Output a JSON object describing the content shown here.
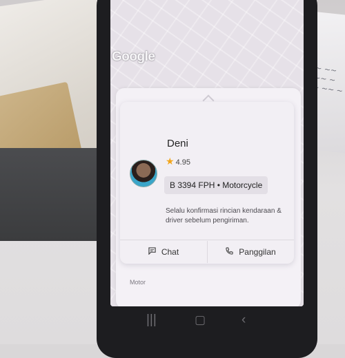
{
  "map": {
    "logo": "Google"
  },
  "driver": {
    "name": "Deni",
    "rating": "4.95",
    "vehicle": "B 3394 FPH • Motorcycle",
    "note": "Selalu konfirmasi rincian kendaraan & driver sebelum pengiriman."
  },
  "actions": {
    "chat_label": "Chat",
    "call_label": "Panggilan"
  },
  "service": {
    "label": "Motor"
  },
  "icons": {
    "star": "star-icon",
    "chat": "chat-icon",
    "phone": "phone-icon",
    "recents": "recents-icon",
    "home": "home-icon",
    "back": "back-icon"
  },
  "colors": {
    "star": "#f2a51b",
    "sheet_bg": "#f2eff4"
  }
}
